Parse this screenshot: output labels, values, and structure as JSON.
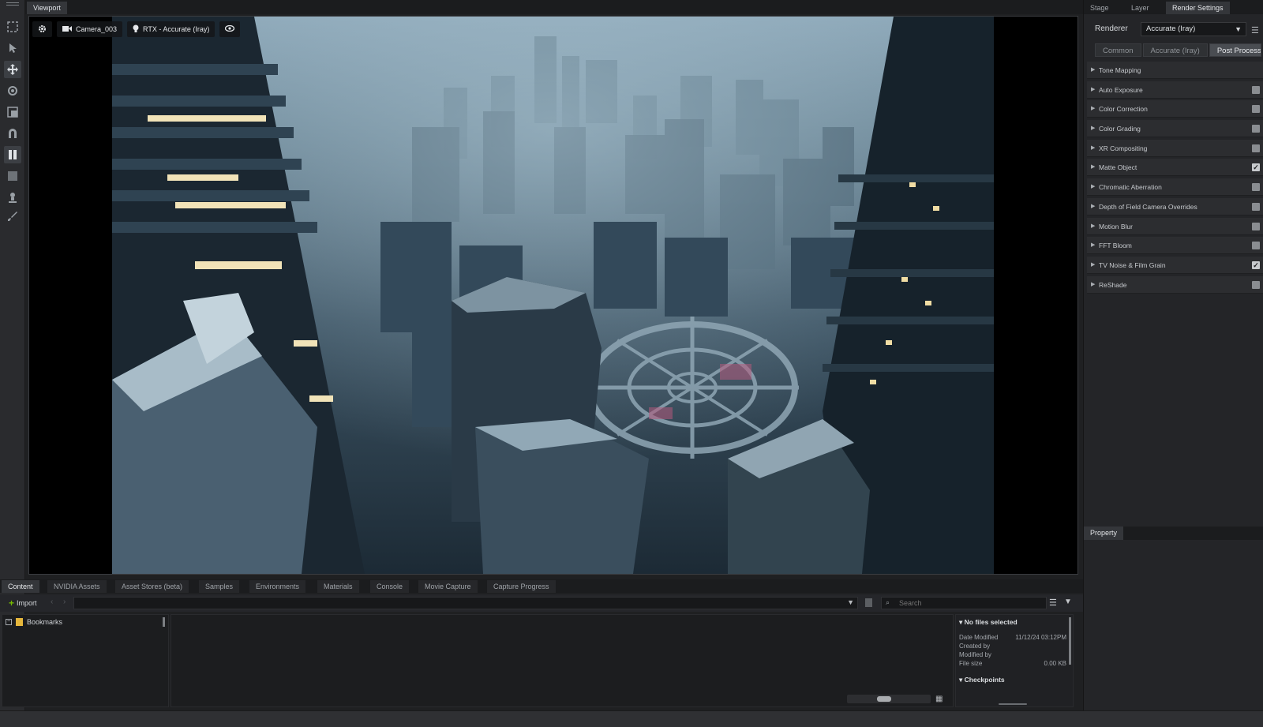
{
  "viewport": {
    "tab_label": "Viewport",
    "camera_label": "Camera_003",
    "render_mode_label": "RTX - Accurate (Iray)"
  },
  "left_toolbar": {
    "tools": [
      "select-icon",
      "pointer-icon",
      "move-icon",
      "rotate-icon",
      "scale-icon",
      "snap-icon",
      "pause-icon",
      "stop-icon",
      "light-icon",
      "brush-icon"
    ]
  },
  "right_panel": {
    "tabs": [
      "Stage",
      "Layer",
      "Render Settings"
    ],
    "active_tab": "Render Settings",
    "renderer_label": "Renderer",
    "renderer_value": "Accurate (Iray)",
    "subtabs": [
      "Common",
      "Accurate (Iray)",
      "Post Processing"
    ],
    "active_subtab": "Post Processing",
    "post_processing_items": [
      {
        "label": "Tone Mapping",
        "checkbox": false,
        "checked": false
      },
      {
        "label": "Auto Exposure",
        "checkbox": true,
        "checked": false
      },
      {
        "label": "Color Correction",
        "checkbox": true,
        "checked": false
      },
      {
        "label": "Color Grading",
        "checkbox": true,
        "checked": false
      },
      {
        "label": "XR Compositing",
        "checkbox": true,
        "checked": false
      },
      {
        "label": "Matte Object",
        "checkbox": true,
        "checked": true
      },
      {
        "label": "Chromatic Aberration",
        "checkbox": true,
        "checked": false
      },
      {
        "label": "Depth of Field Camera Overrides",
        "checkbox": true,
        "checked": false
      },
      {
        "label": "Motion Blur",
        "checkbox": true,
        "checked": false
      },
      {
        "label": "FFT Bloom",
        "checkbox": true,
        "checked": false
      },
      {
        "label": "TV Noise & Film Grain",
        "checkbox": true,
        "checked": true
      },
      {
        "label": "ReShade",
        "checkbox": true,
        "checked": false
      }
    ],
    "property_tab": "Property"
  },
  "bottom_panel": {
    "tabs": [
      "Content",
      "NVIDIA Assets",
      "Asset Stores (beta)",
      "Samples",
      "Environments",
      "Materials",
      "Console",
      "Movie Capture",
      "Capture Progress"
    ],
    "active_tab": "Content",
    "import_label": "Import",
    "search_placeholder": "Search",
    "tree": {
      "bookmarks_label": "Bookmarks"
    },
    "info": {
      "header": "No files selected",
      "date_modified_label": "Date Modified",
      "date_modified_value": "11/12/24 03:12PM",
      "created_by_label": "Created by",
      "modified_by_label": "Modified by",
      "file_size_label": "File size",
      "file_size_value": "0.00 KB",
      "checkpoints_header": "Checkpoints"
    }
  },
  "colors": {
    "accent_green": "#76b900",
    "bookmark_yellow": "#e6b73c",
    "panel_bg": "#242528"
  }
}
